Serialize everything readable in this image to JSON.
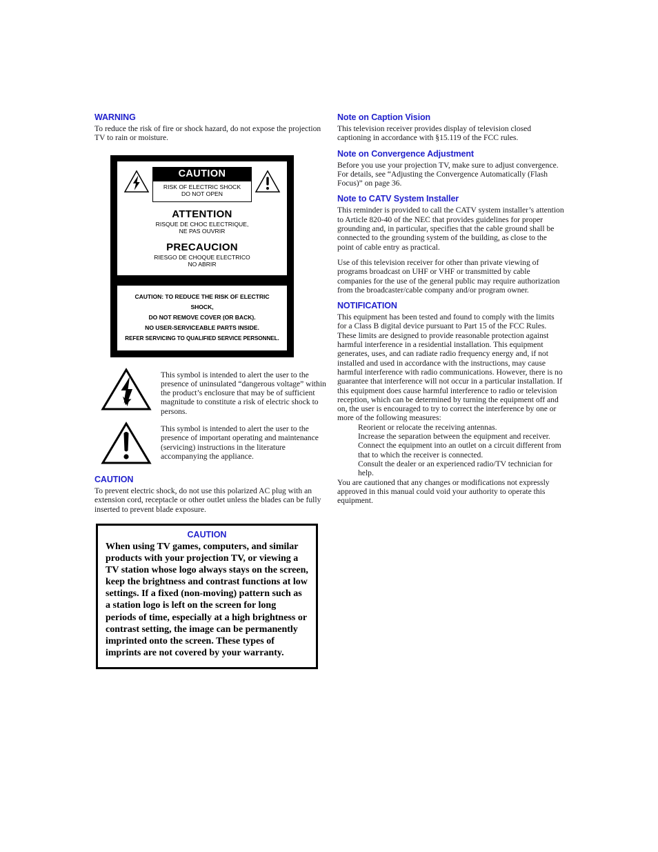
{
  "document": {
    "page_background": "#ffffff",
    "heading_color": "#2222cc"
  },
  "left_column": {
    "warning": {
      "heading": "WARNING",
      "body": "To reduce the risk of fire or shock hazard, do not expose the projection TV to rain or moisture."
    },
    "safety_graphic": {
      "caution_bar": "CAUTION",
      "caution_sub_line1": "RISK OF ELECTRIC SHOCK",
      "caution_sub_line2": "DO NOT OPEN",
      "attention_title": "ATTENTION",
      "attention_sub_line1": "RISQUE DE CHOC ELECTRIQUE,",
      "attention_sub_line2": "NE PAS OUVRIR",
      "precaucion_title": "PRECAUCION",
      "precaucion_sub_line1": "RIESGO DE CHOQUE ELECTRICO",
      "precaucion_sub_line2": "NO ABRIR",
      "service_line1": "CAUTION:  TO REDUCE THE RISK OF ELECTRIC SHOCK,",
      "service_line2": "DO NOT REMOVE COVER (OR BACK).",
      "service_line3": "NO USER-SERVICEABLE PARTS INSIDE.",
      "service_line4": "REFER SERVICING TO QUALIFIED SERVICE PERSONNEL."
    },
    "symbols": [
      {
        "icon": "lightning-bolt-triangle-icon",
        "text": "This symbol is intended to alert the user to the presence of uninsulated “dangerous voltage” within the product’s enclosure that may be of sufficient magnitude to constitute a risk of electric shock to persons."
      },
      {
        "icon": "exclamation-triangle-icon",
        "text": "This symbol is intended to alert the user to the presence of important operating and maintenance (servicing) instructions in the literature accompanying the appliance."
      }
    ],
    "caution": {
      "heading": "CAUTION",
      "body": "To prevent electric shock, do not use this polarized AC plug with an extension cord, receptacle or other outlet unless the blades can be fully inserted to prevent blade exposure."
    },
    "caution_box": {
      "title": "CAUTION",
      "body": "When using TV games, computers, and similar products with your projection TV, or viewing a TV station whose logo always stays on the screen, keep the brightness and contrast functions at low settings. If a fixed (non-moving) pattern such as a station logo is left on the screen for long periods of time, especially at a high brightness or contrast setting, the image can be permanently imprinted onto the screen. These types of imprints are not covered by your warranty."
    }
  },
  "right_column": {
    "caption_vision": {
      "heading": "Note on Caption Vision",
      "body": "This television receiver provides display of television closed captioning in accordance with §15.119 of the FCC rules."
    },
    "convergence": {
      "heading": "Note on Convergence Adjustment",
      "body": "Before you use your projection TV, make sure to adjust convergence. For details, see “Adjusting the Convergence Automatically (Flash Focus)” on page 36."
    },
    "catv": {
      "heading": "Note to CATV System Installer",
      "body1": "This reminder is provided to call the CATV system installer’s attention to Article 820-40 of the NEC that provides guidelines for proper grounding and, in particular, specifies that the cable ground shall be connected to the grounding system of the building, as close to the point of cable entry as practical.",
      "body2": "Use of this television receiver for other than private viewing of programs broadcast on UHF or VHF or transmitted by cable companies for the use of the general public may require authorization from the broadcaster/cable company and/or program owner."
    },
    "notification": {
      "heading": "NOTIFICATION",
      "body1": "This equipment has been tested and found to comply with the limits for a Class B digital device pursuant to Part 15 of the FCC Rules. These limits are designed to provide reasonable protection against harmful interference in a residential installation. This equipment generates, uses, and can radiate radio frequency energy and, if not installed and used in accordance with the instructions, may cause harmful interference with radio communications. However, there is no guarantee that interference will not occur in a particular installation. If this equipment does cause harmful interference to radio or television reception, which can be determined by turning the equipment off and on, the user is encouraged to try to correct the interference by one or more of the following measures:",
      "measures": [
        "Reorient or relocate the receiving antennas.",
        "Increase the separation between the equipment and receiver.",
        "Connect the equipment into an outlet on a circuit different from that to which the receiver is connected.",
        "Consult the dealer or an experienced radio/TV technician for help."
      ],
      "body2": "You are cautioned that any changes or modifications not expressly approved in this manual could void your authority to operate this equipment."
    }
  }
}
